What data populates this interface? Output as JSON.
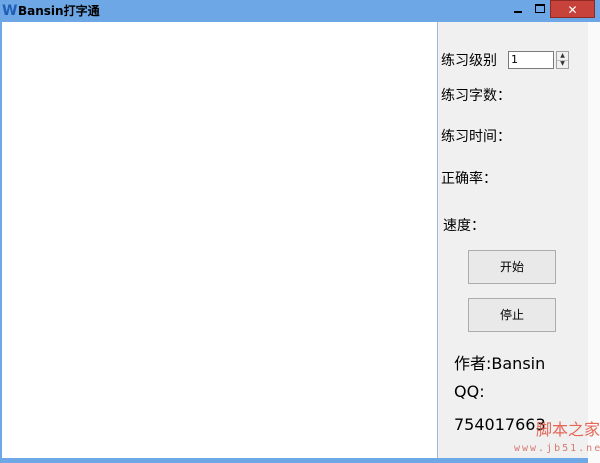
{
  "window": {
    "title": "Bansin打字通",
    "icon": "W",
    "close_symbol": "✕"
  },
  "settings": {
    "level_label": "练习级别",
    "level_value": "1",
    "char_count_label": "练习字数：",
    "time_label": "练习时间：",
    "accuracy_label": "正确率：",
    "speed_label": "速度："
  },
  "buttons": {
    "start_label": "开始",
    "stop_label": "停止"
  },
  "author": {
    "author_line": "作者:Bansin",
    "qq_label": "QQ:",
    "qq_number": "754017663"
  },
  "watermark": {
    "text": "脚本之家",
    "url": "www.jb51.net"
  },
  "colors": {
    "titlebar": "#6ea7e5",
    "close_button": "#c7423a",
    "client_bg": "#f0f0f0"
  }
}
